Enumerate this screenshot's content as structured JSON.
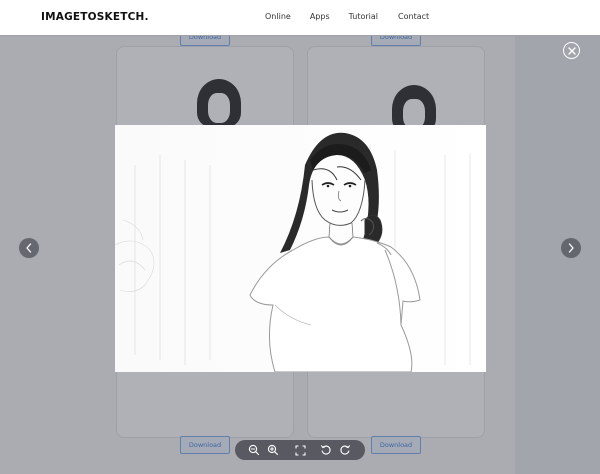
{
  "header": {
    "logo": "IMAGETOSKETCH.",
    "nav": [
      "Online",
      "Apps",
      "Tutorial",
      "Contact"
    ]
  },
  "gallery": {
    "download_label": "Download"
  },
  "viewer": {
    "icons": {
      "close": "close-icon",
      "prev": "chevron-left-icon",
      "next": "chevron-right-icon",
      "zoom_out": "zoom-out-icon",
      "zoom_in": "zoom-in-icon",
      "fullscreen": "fullscreen-icon",
      "rotate_left": "rotate-left-icon",
      "rotate_right": "rotate-right-icon"
    }
  },
  "colors": {
    "overlay": "#40445060",
    "accent": "#3d7be0"
  }
}
